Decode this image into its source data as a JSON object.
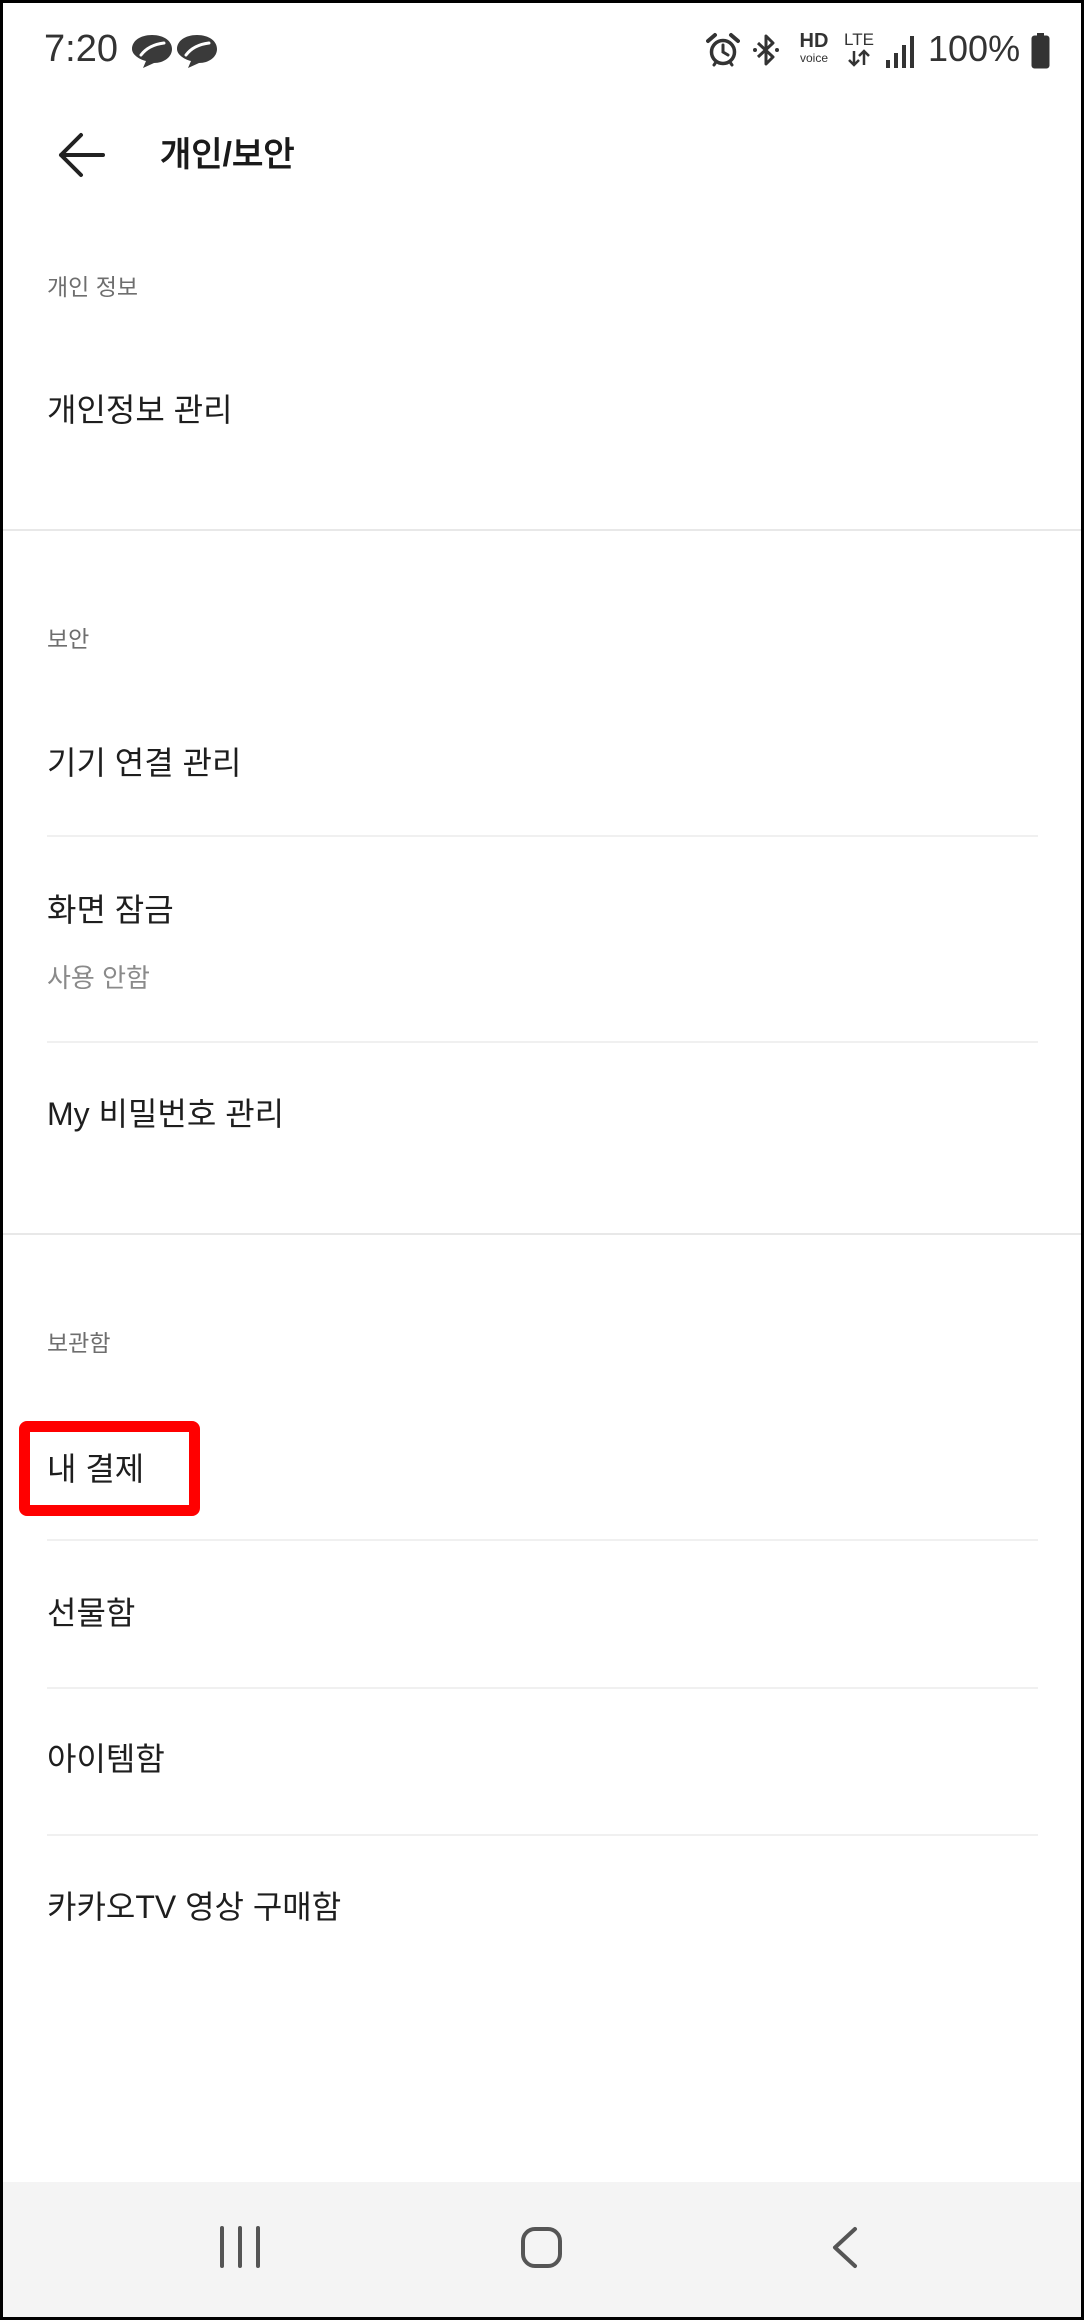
{
  "status_bar": {
    "time": "7:20",
    "notification_icons": [
      "app-notification-icon",
      "app-notification-icon"
    ],
    "system_icons": [
      "alarm-icon",
      "bluetooth-icon",
      "hd-voice-icon",
      "lte-data-icon",
      "signal-icon",
      "battery-icon"
    ],
    "hd_voice_label": "HD",
    "hd_voice_sublabel": "voice",
    "network": "LTE",
    "signal_bars": 4,
    "battery_text": "100%",
    "battery_level": 1.0
  },
  "header": {
    "title": "개인/보안",
    "back_icon": "back-arrow-icon"
  },
  "sections": [
    {
      "label": "개인 정보",
      "items": [
        {
          "label": "개인정보 관리"
        }
      ]
    },
    {
      "label": "보안",
      "items": [
        {
          "label": "기기 연결 관리"
        },
        {
          "label": "화면 잠금",
          "subtitle": "사용 안함"
        },
        {
          "label": "My 비밀번호 관리"
        }
      ]
    },
    {
      "label": "보관함",
      "items": [
        {
          "label": "내 결제",
          "highlighted": true
        },
        {
          "label": "선물함"
        },
        {
          "label": "아이템함"
        },
        {
          "label": "카카오TV 영상 구매함"
        }
      ]
    }
  ],
  "highlight": {
    "color": "#ff0000"
  },
  "colors": {
    "text": "#1e1e1e",
    "section_label": "#6e6e6e",
    "subtitle": "#8a8a8a",
    "divider": "#e8e8e8",
    "nav_background": "#f4f4f4"
  },
  "nav_bar": {
    "icons": [
      "recent-apps-icon",
      "home-icon",
      "back-icon"
    ]
  }
}
